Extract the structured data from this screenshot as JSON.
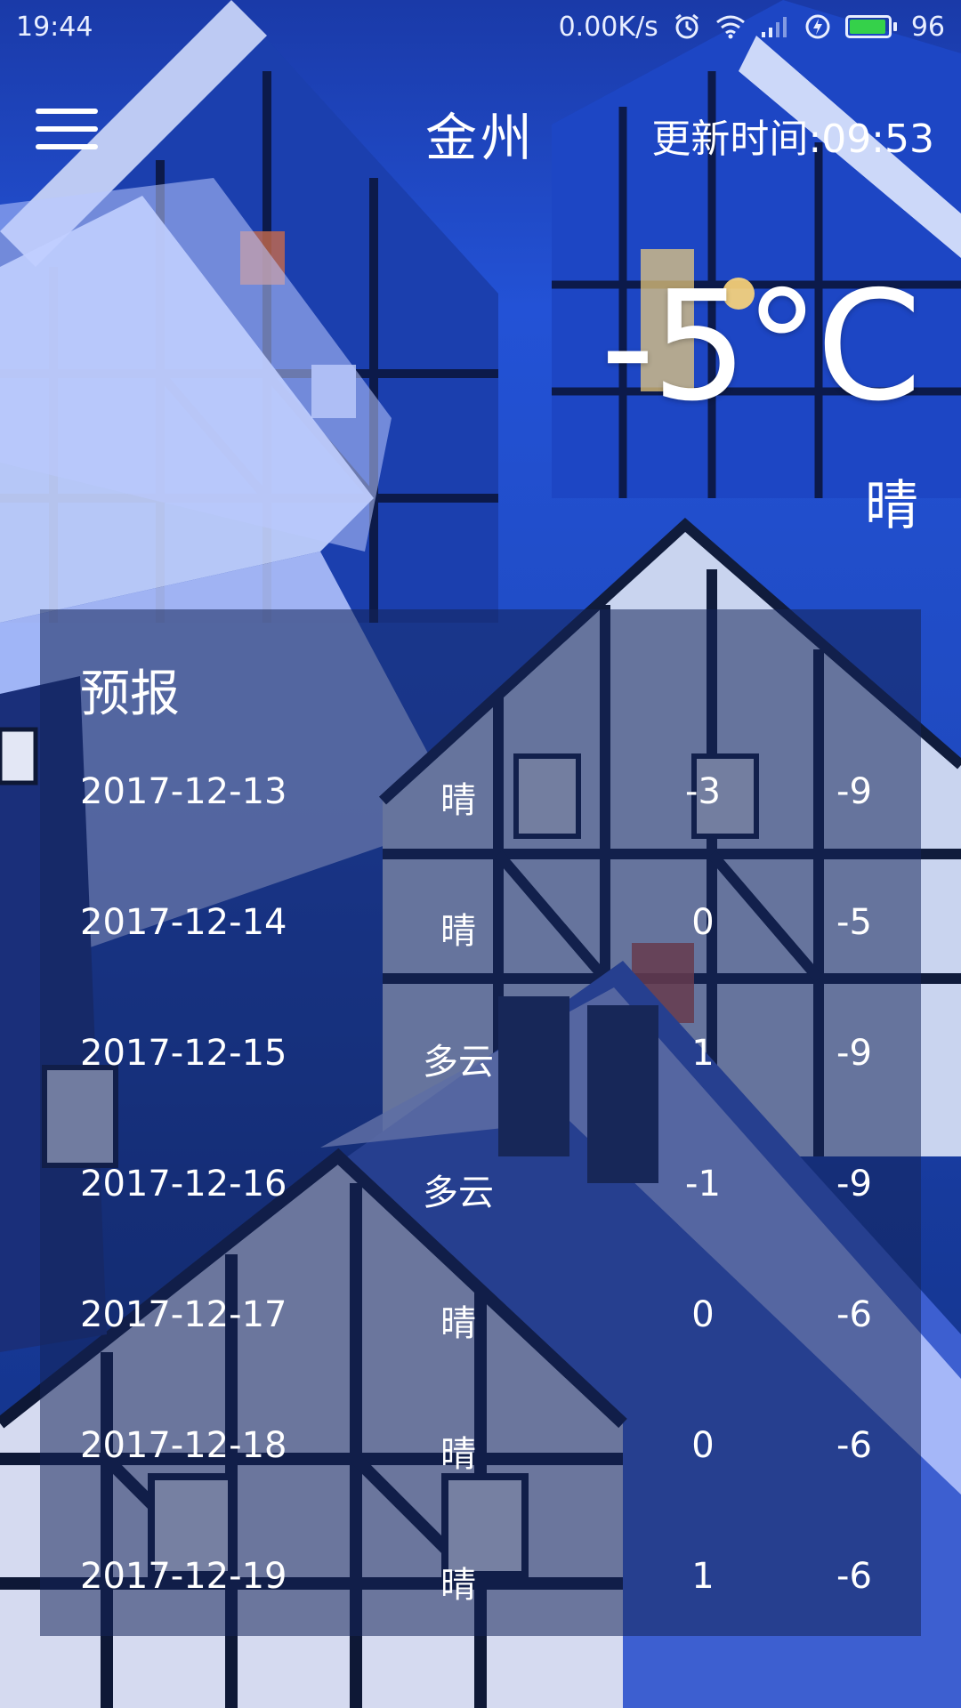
{
  "status_bar": {
    "time": "19:44",
    "net_speed": "0.00K/s",
    "battery_level": "96",
    "icons": [
      "alarm-icon",
      "wifi-icon",
      "signal-icon",
      "charging-icon",
      "battery-icon"
    ]
  },
  "header": {
    "city": "金州",
    "update_time": "更新时间:09:53",
    "menu_icon": "menu-icon"
  },
  "current": {
    "temperature": "-5°C",
    "condition": "晴"
  },
  "forecast": {
    "title": "预报",
    "rows": [
      {
        "date": "2017-12-13",
        "condition": "晴",
        "high": "-3",
        "low": "-9"
      },
      {
        "date": "2017-12-14",
        "condition": "晴",
        "high": "0",
        "low": "-5"
      },
      {
        "date": "2017-12-15",
        "condition": "多云",
        "high": "1",
        "low": "-9"
      },
      {
        "date": "2017-12-16",
        "condition": "多云",
        "high": "-1",
        "low": "-9"
      },
      {
        "date": "2017-12-17",
        "condition": "晴",
        "high": "0",
        "low": "-6"
      },
      {
        "date": "2017-12-18",
        "condition": "晴",
        "high": "0",
        "low": "-6"
      },
      {
        "date": "2017-12-19",
        "condition": "晴",
        "high": "1",
        "low": "-6"
      }
    ]
  },
  "colors": {
    "sky_blue": "#2352d6",
    "panel": "#14245a",
    "battery_green": "#35d14a"
  }
}
